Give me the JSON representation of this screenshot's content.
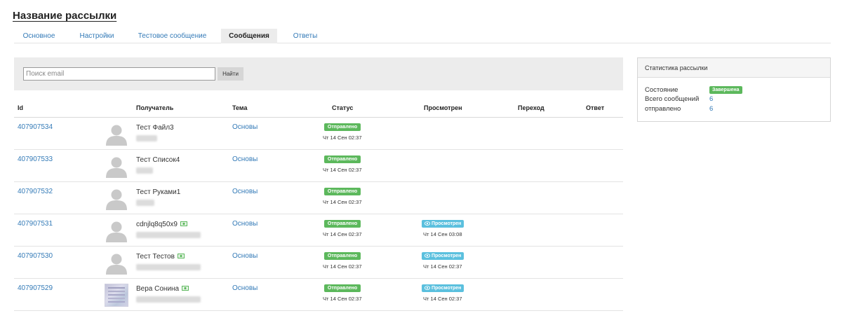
{
  "page": {
    "title": "Название рассылки"
  },
  "tabs": [
    {
      "label": "Основное"
    },
    {
      "label": "Настройки"
    },
    {
      "label": "Тестовое сообщение"
    },
    {
      "label": "Сообщения"
    },
    {
      "label": "Ответы"
    }
  ],
  "active_tab": "Сообщения",
  "search": {
    "placeholder": "Поиск email",
    "value": "",
    "button_label": "Найти"
  },
  "table": {
    "headers": [
      "Id",
      "Получатель",
      "Тема",
      "Статус",
      "Просмотрен",
      "Переход",
      "Ответ"
    ],
    "rows": [
      {
        "id": "407907534",
        "name": "Тест Файл3",
        "verified": false,
        "avatar": "placeholder",
        "theme": "Основы",
        "status": "Отправлено",
        "status_date": "Чт 14 Сен 02:37",
        "viewed": "",
        "viewed_date": ""
      },
      {
        "id": "407907533",
        "name": "Тест Список4",
        "verified": false,
        "avatar": "placeholder",
        "theme": "Основы",
        "status": "Отправлено",
        "status_date": "Чт 14 Сен 02:37",
        "viewed": "",
        "viewed_date": ""
      },
      {
        "id": "407907532",
        "name": "Тест Руками1",
        "verified": false,
        "avatar": "placeholder",
        "theme": "Основы",
        "status": "Отправлено",
        "status_date": "Чт 14 Сен 02:37",
        "viewed": "",
        "viewed_date": ""
      },
      {
        "id": "407907531",
        "name": "cdnjlq8q50x9",
        "verified": true,
        "avatar": "placeholder",
        "theme": "Основы",
        "status": "Отправлено",
        "status_date": "Чт 14 Сен 02:37",
        "viewed": "Просмотрен",
        "viewed_date": "Чт 14 Сен 03:08"
      },
      {
        "id": "407907530",
        "name": "Тест Тестов",
        "verified": true,
        "avatar": "placeholder",
        "theme": "Основы",
        "status": "Отправлено",
        "status_date": "Чт 14 Сен 02:37",
        "viewed": "Просмотрен",
        "viewed_date": "Чт 14 Сен 02:37"
      },
      {
        "id": "407907529",
        "name": "Вера Сонина",
        "verified": true,
        "avatar": "photo",
        "theme": "Основы",
        "status": "Отправлено",
        "status_date": "Чт 14 Сен 02:37",
        "viewed": "Просмотрен",
        "viewed_date": "Чт 14 Сен 02:37"
      }
    ]
  },
  "stats": {
    "title": "Статистика рассылки",
    "state_label": "Состояние",
    "state_value": "Завершена",
    "total_label": "Всего сообщений",
    "total_value": "6",
    "sent_label": "отправлено",
    "sent_value": "6"
  },
  "colors": {
    "link": "#337ab7",
    "success": "#5cb85c",
    "info": "#5bc0de",
    "panel_bg": "#ececec"
  },
  "icons": {
    "avatar": "user-silhouette-icon",
    "verified": "email-verified-icon",
    "viewed": "eye-icon"
  }
}
